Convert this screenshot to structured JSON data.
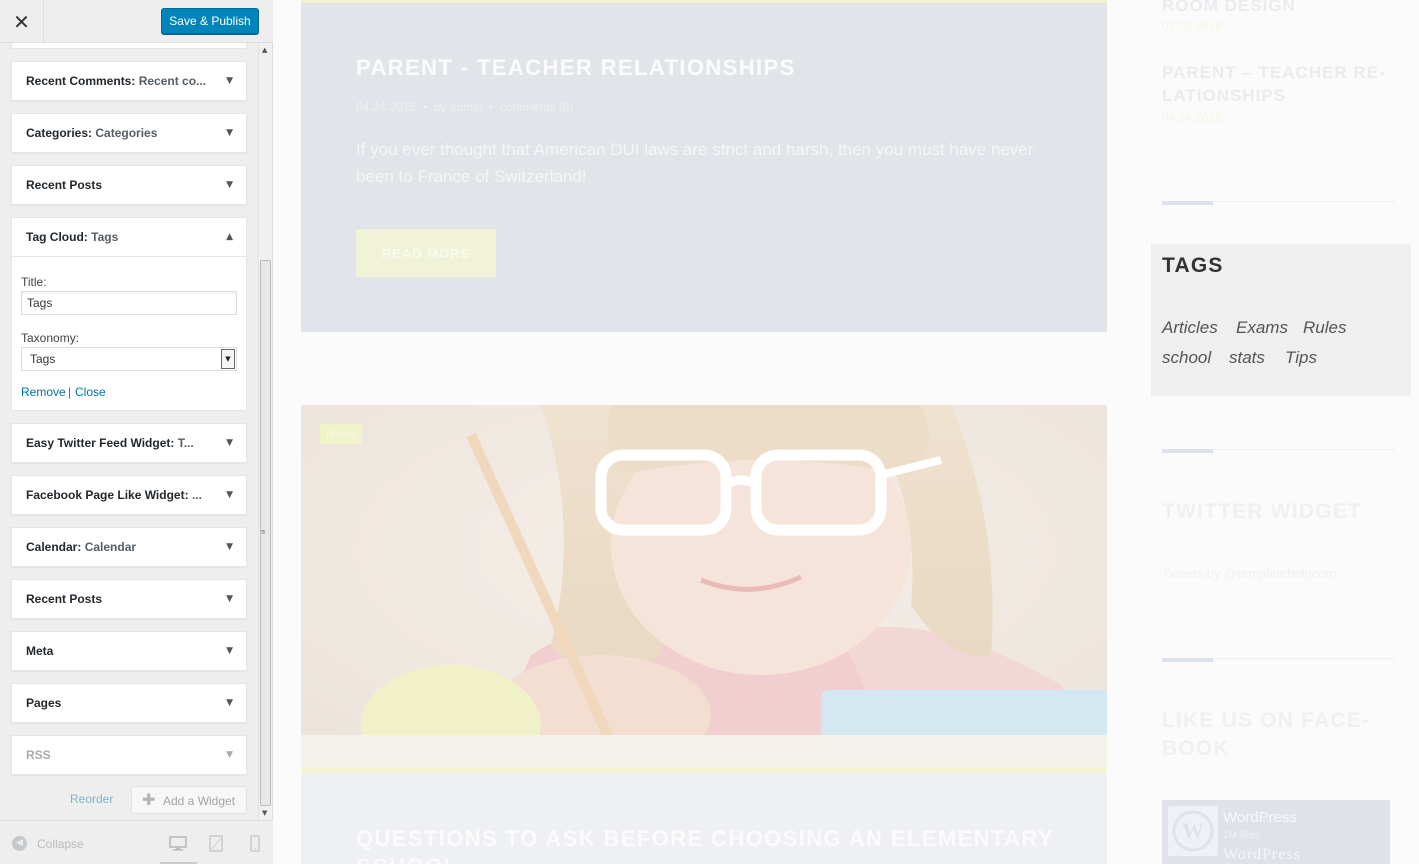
{
  "customizer": {
    "close_glyph": "✕",
    "save_label": "Save & Publish",
    "widgets_before": [
      {
        "name": "Recent Comments",
        "sep": ": ",
        "sub": "Recent co..."
      },
      {
        "name": "Categories",
        "sep": ": ",
        "sub": "Categories"
      },
      {
        "name": "Recent Posts",
        "sep": "",
        "sub": ""
      }
    ],
    "tag_widget": {
      "name": "Tag Cloud",
      "sep": ": ",
      "sub": "Tags",
      "expanded_glyph": "▲",
      "title_label": "Title:",
      "title_value": "Tags",
      "taxonomy_label": "Taxonomy:",
      "taxonomy_value": "Tags",
      "remove_label": "Remove",
      "separator": "|",
      "close_label": "Close"
    },
    "widgets_after": [
      {
        "name": "Easy Twitter Feed Widget",
        "sep": ": ",
        "sub": "T..."
      },
      {
        "name": "Facebook Page Like Widget",
        "sep": ": ",
        "sub": "..."
      },
      {
        "name": "Calendar",
        "sep": ": ",
        "sub": "Calendar"
      },
      {
        "name": "Recent Posts",
        "sep": "",
        "sub": ""
      },
      {
        "name": "Meta",
        "sep": "",
        "sub": ""
      },
      {
        "name": "Pages",
        "sep": "",
        "sub": ""
      },
      {
        "name": "RSS",
        "sep": "",
        "sub": ""
      }
    ],
    "collapsed_glyph": "▼",
    "reorder_label": "Reorder",
    "add_widget_label": "Add a Widget",
    "collapse_label": "Collapse",
    "device_icons": [
      "desktop-icon",
      "tablet-icon",
      "mobile-icon"
    ]
  },
  "preview": {
    "post1": {
      "title": "PARENT - TEACHER RELATIONSHIPS",
      "date": "04.24.2016",
      "author": "by admin",
      "comments": "comments (0)",
      "bullet": "•",
      "excerpt": "If you ever thought that American DUI laws are strict and harsh, then you must have never been to France of Switzerland!",
      "read_more": "READ MORE"
    },
    "post2": {
      "category_tag": "News",
      "image": "girl-with-glasses-drawing"
    },
    "post3": {
      "title": "QUESTIONS TO ASK BEFORE CHOOSING AN ELEMENTARY SCHOOL"
    },
    "sidebar": {
      "recent_1_title": "ROOM DESIGN",
      "recent_1_date": "03.03.2016",
      "recent_2_title_line1": "PARENT – TEACHER RE-",
      "recent_2_title_line2": "LATIONSHIPS",
      "recent_2_date": "04.24.2016",
      "tags_title": "TAGS",
      "tags": [
        "Articles",
        "Exams",
        "Rules",
        "school",
        "stats",
        "Tips"
      ],
      "twitter_title": "TWITTER WIDGET",
      "tweets_by": "Tweets by @templatehelpcom",
      "facebook_title": "LIKE US ON FACE-BOOK",
      "fb_page_name": "WordPress",
      "fb_likes": "1M likes",
      "fb_wordmark": "WordPress"
    }
  },
  "colors": {
    "primary_button": "#0085ba",
    "link": "#0073aa",
    "panel_bg": "#eeeeee"
  }
}
